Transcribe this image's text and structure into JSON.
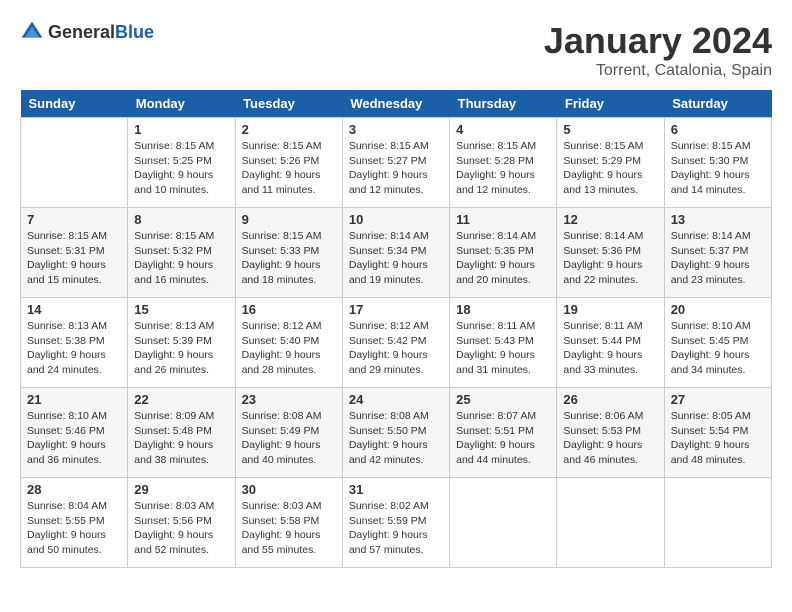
{
  "logo": {
    "general": "General",
    "blue": "Blue"
  },
  "header": {
    "month": "January 2024",
    "location": "Torrent, Catalonia, Spain"
  },
  "weekdays": [
    "Sunday",
    "Monday",
    "Tuesday",
    "Wednesday",
    "Thursday",
    "Friday",
    "Saturday"
  ],
  "weeks": [
    [
      {
        "day": "",
        "sunrise": "",
        "sunset": "",
        "daylight": ""
      },
      {
        "day": "1",
        "sunrise": "Sunrise: 8:15 AM",
        "sunset": "Sunset: 5:25 PM",
        "daylight": "Daylight: 9 hours and 10 minutes."
      },
      {
        "day": "2",
        "sunrise": "Sunrise: 8:15 AM",
        "sunset": "Sunset: 5:26 PM",
        "daylight": "Daylight: 9 hours and 11 minutes."
      },
      {
        "day": "3",
        "sunrise": "Sunrise: 8:15 AM",
        "sunset": "Sunset: 5:27 PM",
        "daylight": "Daylight: 9 hours and 12 minutes."
      },
      {
        "day": "4",
        "sunrise": "Sunrise: 8:15 AM",
        "sunset": "Sunset: 5:28 PM",
        "daylight": "Daylight: 9 hours and 12 minutes."
      },
      {
        "day": "5",
        "sunrise": "Sunrise: 8:15 AM",
        "sunset": "Sunset: 5:29 PM",
        "daylight": "Daylight: 9 hours and 13 minutes."
      },
      {
        "day": "6",
        "sunrise": "Sunrise: 8:15 AM",
        "sunset": "Sunset: 5:30 PM",
        "daylight": "Daylight: 9 hours and 14 minutes."
      }
    ],
    [
      {
        "day": "7",
        "sunrise": "Sunrise: 8:15 AM",
        "sunset": "Sunset: 5:31 PM",
        "daylight": "Daylight: 9 hours and 15 minutes."
      },
      {
        "day": "8",
        "sunrise": "Sunrise: 8:15 AM",
        "sunset": "Sunset: 5:32 PM",
        "daylight": "Daylight: 9 hours and 16 minutes."
      },
      {
        "day": "9",
        "sunrise": "Sunrise: 8:15 AM",
        "sunset": "Sunset: 5:33 PM",
        "daylight": "Daylight: 9 hours and 18 minutes."
      },
      {
        "day": "10",
        "sunrise": "Sunrise: 8:14 AM",
        "sunset": "Sunset: 5:34 PM",
        "daylight": "Daylight: 9 hours and 19 minutes."
      },
      {
        "day": "11",
        "sunrise": "Sunrise: 8:14 AM",
        "sunset": "Sunset: 5:35 PM",
        "daylight": "Daylight: 9 hours and 20 minutes."
      },
      {
        "day": "12",
        "sunrise": "Sunrise: 8:14 AM",
        "sunset": "Sunset: 5:36 PM",
        "daylight": "Daylight: 9 hours and 22 minutes."
      },
      {
        "day": "13",
        "sunrise": "Sunrise: 8:14 AM",
        "sunset": "Sunset: 5:37 PM",
        "daylight": "Daylight: 9 hours and 23 minutes."
      }
    ],
    [
      {
        "day": "14",
        "sunrise": "Sunrise: 8:13 AM",
        "sunset": "Sunset: 5:38 PM",
        "daylight": "Daylight: 9 hours and 24 minutes."
      },
      {
        "day": "15",
        "sunrise": "Sunrise: 8:13 AM",
        "sunset": "Sunset: 5:39 PM",
        "daylight": "Daylight: 9 hours and 26 minutes."
      },
      {
        "day": "16",
        "sunrise": "Sunrise: 8:12 AM",
        "sunset": "Sunset: 5:40 PM",
        "daylight": "Daylight: 9 hours and 28 minutes."
      },
      {
        "day": "17",
        "sunrise": "Sunrise: 8:12 AM",
        "sunset": "Sunset: 5:42 PM",
        "daylight": "Daylight: 9 hours and 29 minutes."
      },
      {
        "day": "18",
        "sunrise": "Sunrise: 8:11 AM",
        "sunset": "Sunset: 5:43 PM",
        "daylight": "Daylight: 9 hours and 31 minutes."
      },
      {
        "day": "19",
        "sunrise": "Sunrise: 8:11 AM",
        "sunset": "Sunset: 5:44 PM",
        "daylight": "Daylight: 9 hours and 33 minutes."
      },
      {
        "day": "20",
        "sunrise": "Sunrise: 8:10 AM",
        "sunset": "Sunset: 5:45 PM",
        "daylight": "Daylight: 9 hours and 34 minutes."
      }
    ],
    [
      {
        "day": "21",
        "sunrise": "Sunrise: 8:10 AM",
        "sunset": "Sunset: 5:46 PM",
        "daylight": "Daylight: 9 hours and 36 minutes."
      },
      {
        "day": "22",
        "sunrise": "Sunrise: 8:09 AM",
        "sunset": "Sunset: 5:48 PM",
        "daylight": "Daylight: 9 hours and 38 minutes."
      },
      {
        "day": "23",
        "sunrise": "Sunrise: 8:08 AM",
        "sunset": "Sunset: 5:49 PM",
        "daylight": "Daylight: 9 hours and 40 minutes."
      },
      {
        "day": "24",
        "sunrise": "Sunrise: 8:08 AM",
        "sunset": "Sunset: 5:50 PM",
        "daylight": "Daylight: 9 hours and 42 minutes."
      },
      {
        "day": "25",
        "sunrise": "Sunrise: 8:07 AM",
        "sunset": "Sunset: 5:51 PM",
        "daylight": "Daylight: 9 hours and 44 minutes."
      },
      {
        "day": "26",
        "sunrise": "Sunrise: 8:06 AM",
        "sunset": "Sunset: 5:53 PM",
        "daylight": "Daylight: 9 hours and 46 minutes."
      },
      {
        "day": "27",
        "sunrise": "Sunrise: 8:05 AM",
        "sunset": "Sunset: 5:54 PM",
        "daylight": "Daylight: 9 hours and 48 minutes."
      }
    ],
    [
      {
        "day": "28",
        "sunrise": "Sunrise: 8:04 AM",
        "sunset": "Sunset: 5:55 PM",
        "daylight": "Daylight: 9 hours and 50 minutes."
      },
      {
        "day": "29",
        "sunrise": "Sunrise: 8:03 AM",
        "sunset": "Sunset: 5:56 PM",
        "daylight": "Daylight: 9 hours and 52 minutes."
      },
      {
        "day": "30",
        "sunrise": "Sunrise: 8:03 AM",
        "sunset": "Sunset: 5:58 PM",
        "daylight": "Daylight: 9 hours and 55 minutes."
      },
      {
        "day": "31",
        "sunrise": "Sunrise: 8:02 AM",
        "sunset": "Sunset: 5:59 PM",
        "daylight": "Daylight: 9 hours and 57 minutes."
      },
      {
        "day": "",
        "sunrise": "",
        "sunset": "",
        "daylight": ""
      },
      {
        "day": "",
        "sunrise": "",
        "sunset": "",
        "daylight": ""
      },
      {
        "day": "",
        "sunrise": "",
        "sunset": "",
        "daylight": ""
      }
    ]
  ]
}
